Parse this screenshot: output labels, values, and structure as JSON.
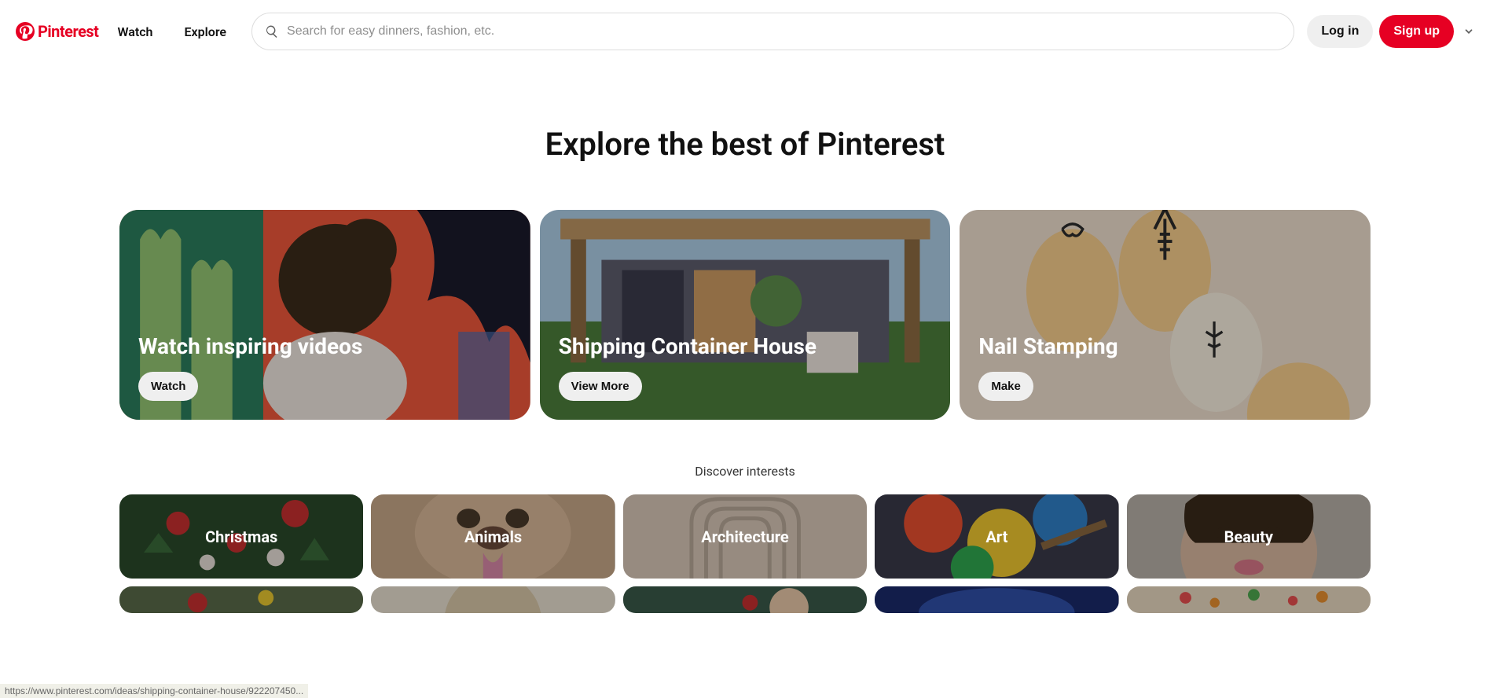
{
  "brand": {
    "name": "Pinterest"
  },
  "nav": {
    "watch": "Watch",
    "explore": "Explore"
  },
  "search": {
    "placeholder": "Search for easy dinners, fashion, etc."
  },
  "auth": {
    "login": "Log in",
    "signup": "Sign up"
  },
  "heading": "Explore the best of Pinterest",
  "features": [
    {
      "title": "Watch inspiring videos",
      "button": "Watch"
    },
    {
      "title": "Shipping Container House",
      "button": "View More"
    },
    {
      "title": "Nail Stamping",
      "button": "Make"
    }
  ],
  "discover_label": "Discover interests",
  "interests_row1": [
    {
      "label": "Christmas"
    },
    {
      "label": "Animals"
    },
    {
      "label": "Architecture"
    },
    {
      "label": "Art"
    },
    {
      "label": "Beauty"
    }
  ],
  "interests_row2": [
    {
      "label": ""
    },
    {
      "label": ""
    },
    {
      "label": ""
    },
    {
      "label": ""
    },
    {
      "label": ""
    }
  ],
  "status_url": "https://www.pinterest.com/ideas/shipping-container-house/922207450..."
}
